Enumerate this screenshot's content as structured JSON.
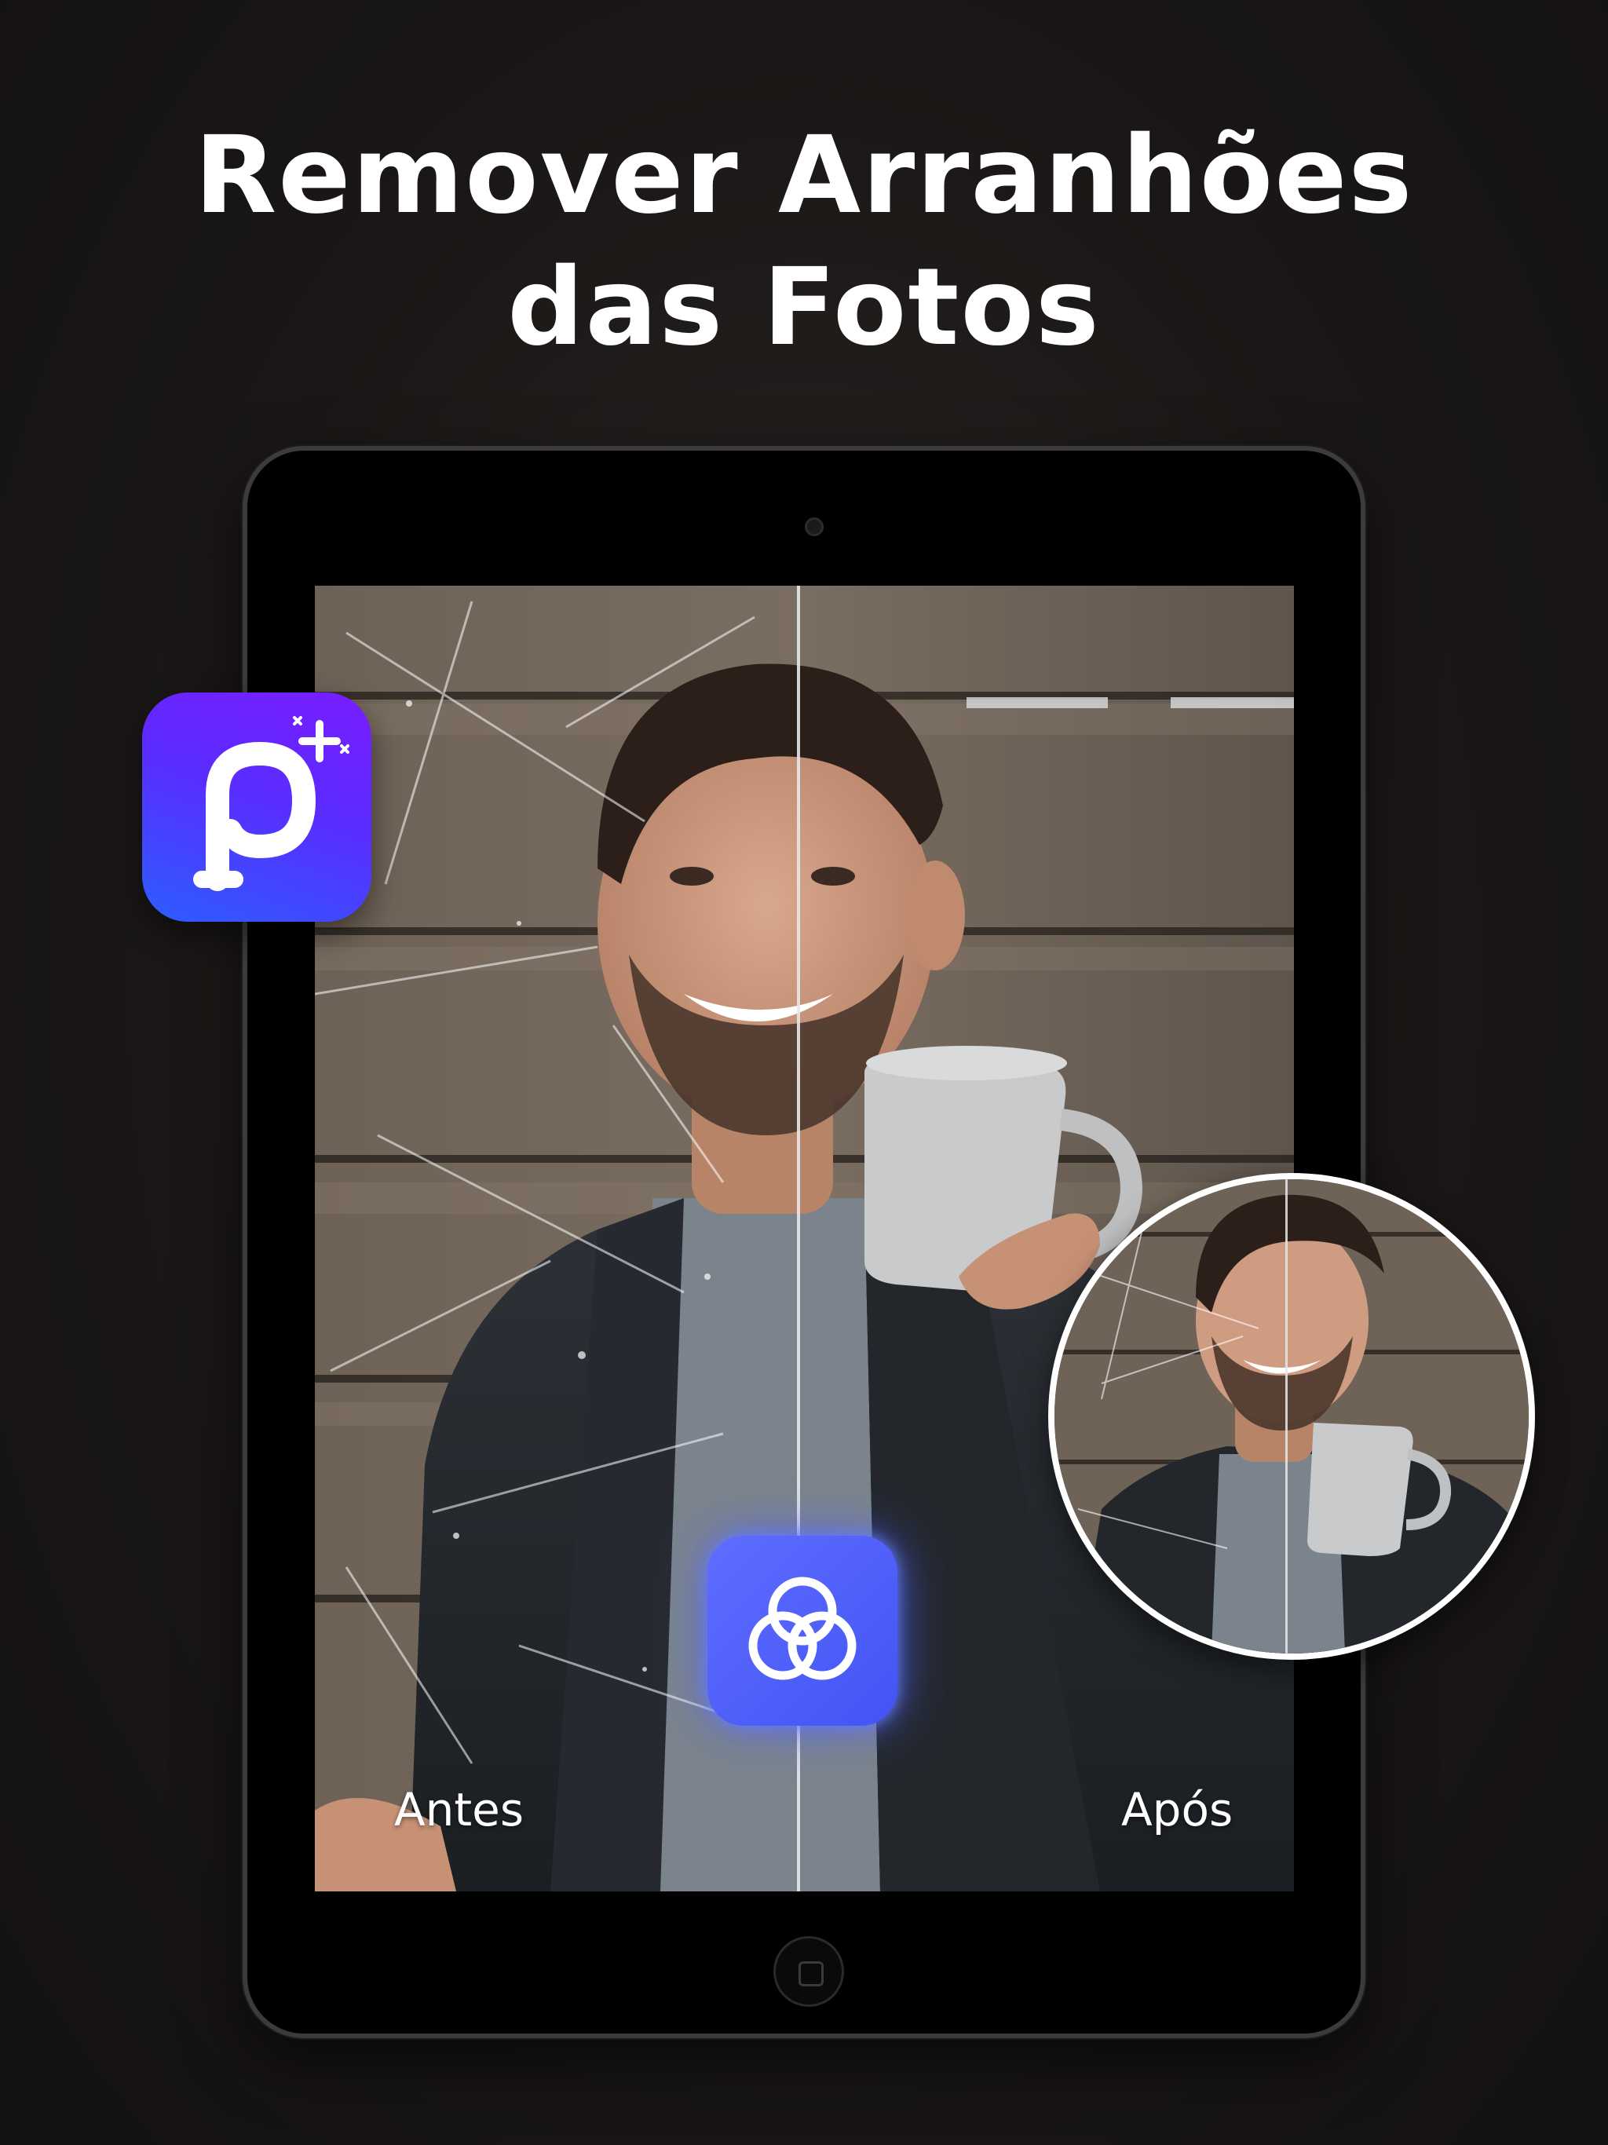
{
  "headline": {
    "line1": "Remover Arranhões",
    "line2": "das Fotos"
  },
  "comparison": {
    "before_label": "Antes",
    "after_label": "Após"
  },
  "icons": {
    "app_logo": "photo-app-logo-icon",
    "compare": "overlapping-circles-icon"
  },
  "colors": {
    "accent": "#4a5cff",
    "logo_gradient_top": "#7a1cff",
    "logo_gradient_bottom": "#2d5dff"
  }
}
